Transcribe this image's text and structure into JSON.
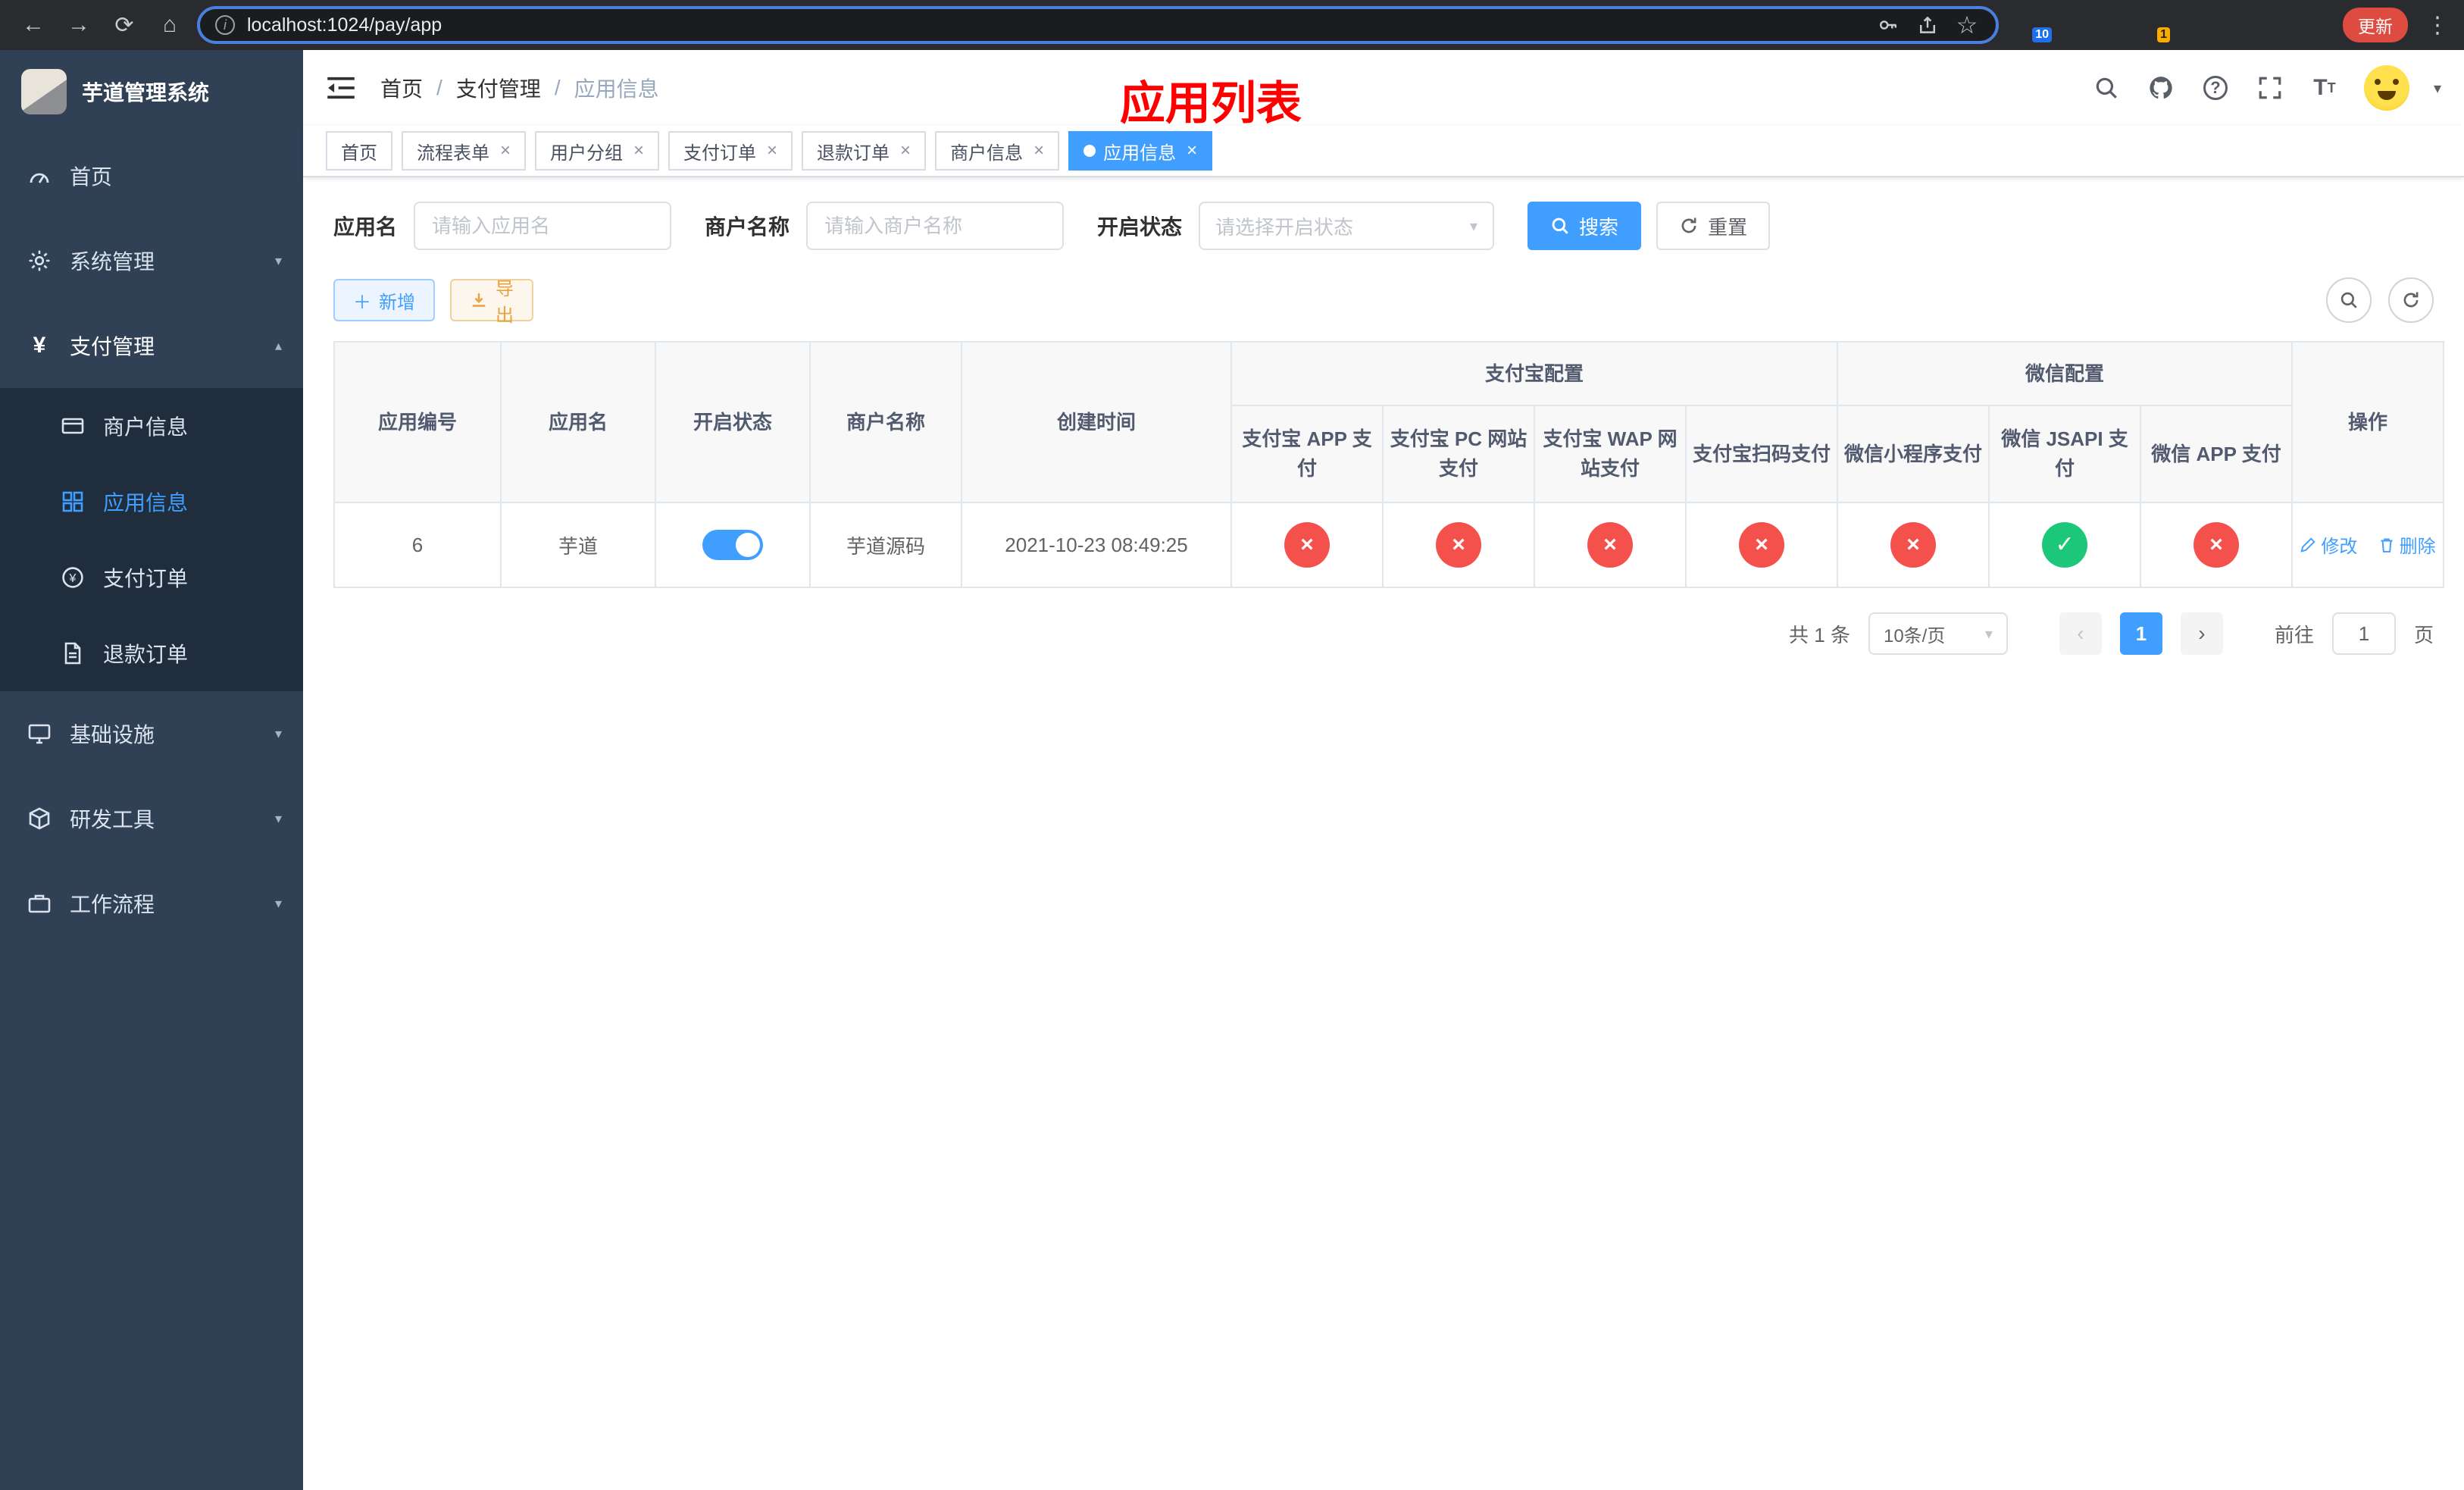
{
  "colors": {
    "accent_blue": "#409EFF",
    "status_off_red": "#F4504C",
    "status_on_green": "#1DC779",
    "title_red": "#FE0000",
    "sidebar_bg": "#304156"
  },
  "browser": {
    "url": "localhost:1024/pay/app",
    "update_label": "更新",
    "ext_badge_a": "10",
    "ext_badge_b": "1"
  },
  "app": {
    "brand": "芋道管理系统",
    "page_title": "应用列表"
  },
  "sidebar": {
    "items": [
      {
        "label": "首页"
      },
      {
        "label": "系统管理"
      },
      {
        "label": "支付管理"
      },
      {
        "label": "基础设施"
      },
      {
        "label": "研发工具"
      },
      {
        "label": "工作流程"
      }
    ],
    "submenu": [
      {
        "label": "商户信息"
      },
      {
        "label": "应用信息"
      },
      {
        "label": "支付订单"
      },
      {
        "label": "退款订单"
      }
    ]
  },
  "breadcrumb": {
    "items": [
      "首页",
      "支付管理",
      "应用信息"
    ]
  },
  "tabs": [
    {
      "label": "首页"
    },
    {
      "label": "流程表单"
    },
    {
      "label": "用户分组"
    },
    {
      "label": "支付订单"
    },
    {
      "label": "退款订单"
    },
    {
      "label": "商户信息"
    },
    {
      "label": "应用信息"
    }
  ],
  "filters": {
    "app_name_label": "应用名",
    "app_name_placeholder": "请输入应用名",
    "merchant_label": "商户名称",
    "merchant_placeholder": "请输入商户名称",
    "status_label": "开启状态",
    "status_placeholder": "请选择开启状态",
    "search_label": "搜索",
    "reset_label": "重置"
  },
  "toolbar": {
    "add_label": "新增",
    "export_label": "导出"
  },
  "table": {
    "columns": {
      "id": "应用编号",
      "name": "应用名",
      "status": "开启状态",
      "merchant": "商户名称",
      "created": "创建时间",
      "alipay_group": "支付宝配置",
      "wechat_group": "微信配置",
      "actions": "操作",
      "alipay": [
        "支付宝 APP 支付",
        "支付宝 PC 网站支付",
        "支付宝 WAP 网站支付",
        "支付宝扫码支付"
      ],
      "wechat": [
        "微信小程序支付",
        "微信 JSAPI 支付",
        "微信 APP 支付"
      ]
    },
    "row": {
      "id": "6",
      "name": "芋道",
      "enabled": true,
      "merchant": "芋道源码",
      "created": "2021-10-23 08:49:25",
      "channels": [
        false,
        false,
        false,
        false,
        false,
        true,
        false
      ],
      "edit_label": "修改",
      "delete_label": "删除"
    }
  },
  "pagination": {
    "total_label": "共 1 条",
    "page_size_label": "10条/页",
    "current_page": "1",
    "goto_label": "前往",
    "goto_value": "1",
    "page_unit": "页"
  }
}
